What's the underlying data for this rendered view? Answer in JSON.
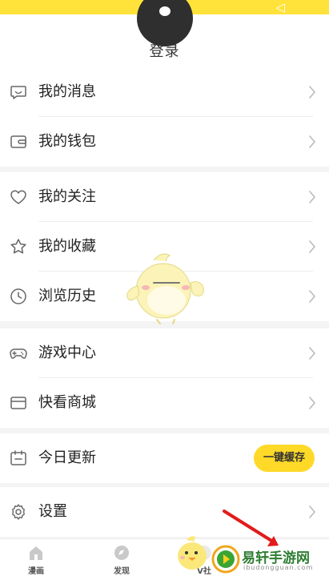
{
  "header": {
    "login_label": "登录"
  },
  "groups": [
    {
      "items": [
        {
          "label": "我的消息",
          "icon": "message-icon"
        },
        {
          "label": "我的钱包",
          "icon": "wallet-icon"
        }
      ]
    },
    {
      "items": [
        {
          "label": "我的关注",
          "icon": "heart-icon"
        },
        {
          "label": "我的收藏",
          "icon": "star-icon"
        },
        {
          "label": "浏览历史",
          "icon": "clock-icon"
        }
      ]
    },
    {
      "items": [
        {
          "label": "游戏中心",
          "icon": "gamepad-icon"
        },
        {
          "label": "快看商城",
          "icon": "store-icon"
        }
      ]
    },
    {
      "items": [
        {
          "label": "今日更新",
          "icon": "calendar-icon",
          "action_label": "一键缓存"
        }
      ]
    },
    {
      "items": [
        {
          "label": "设置",
          "icon": "settings-icon"
        }
      ]
    }
  ],
  "tabbar": {
    "tabs": [
      {
        "label": "漫画",
        "icon": "comic-icon"
      },
      {
        "label": "发现",
        "icon": "discover-icon"
      },
      {
        "label": "V社",
        "icon": "community-icon"
      }
    ]
  },
  "watermark": {
    "title": "易轩手游网",
    "subtitle": "ibudongguan.com"
  },
  "colors": {
    "accent": "#ffd928",
    "top_band": "#ffe33a",
    "watermark_green": "#2e7d32"
  }
}
